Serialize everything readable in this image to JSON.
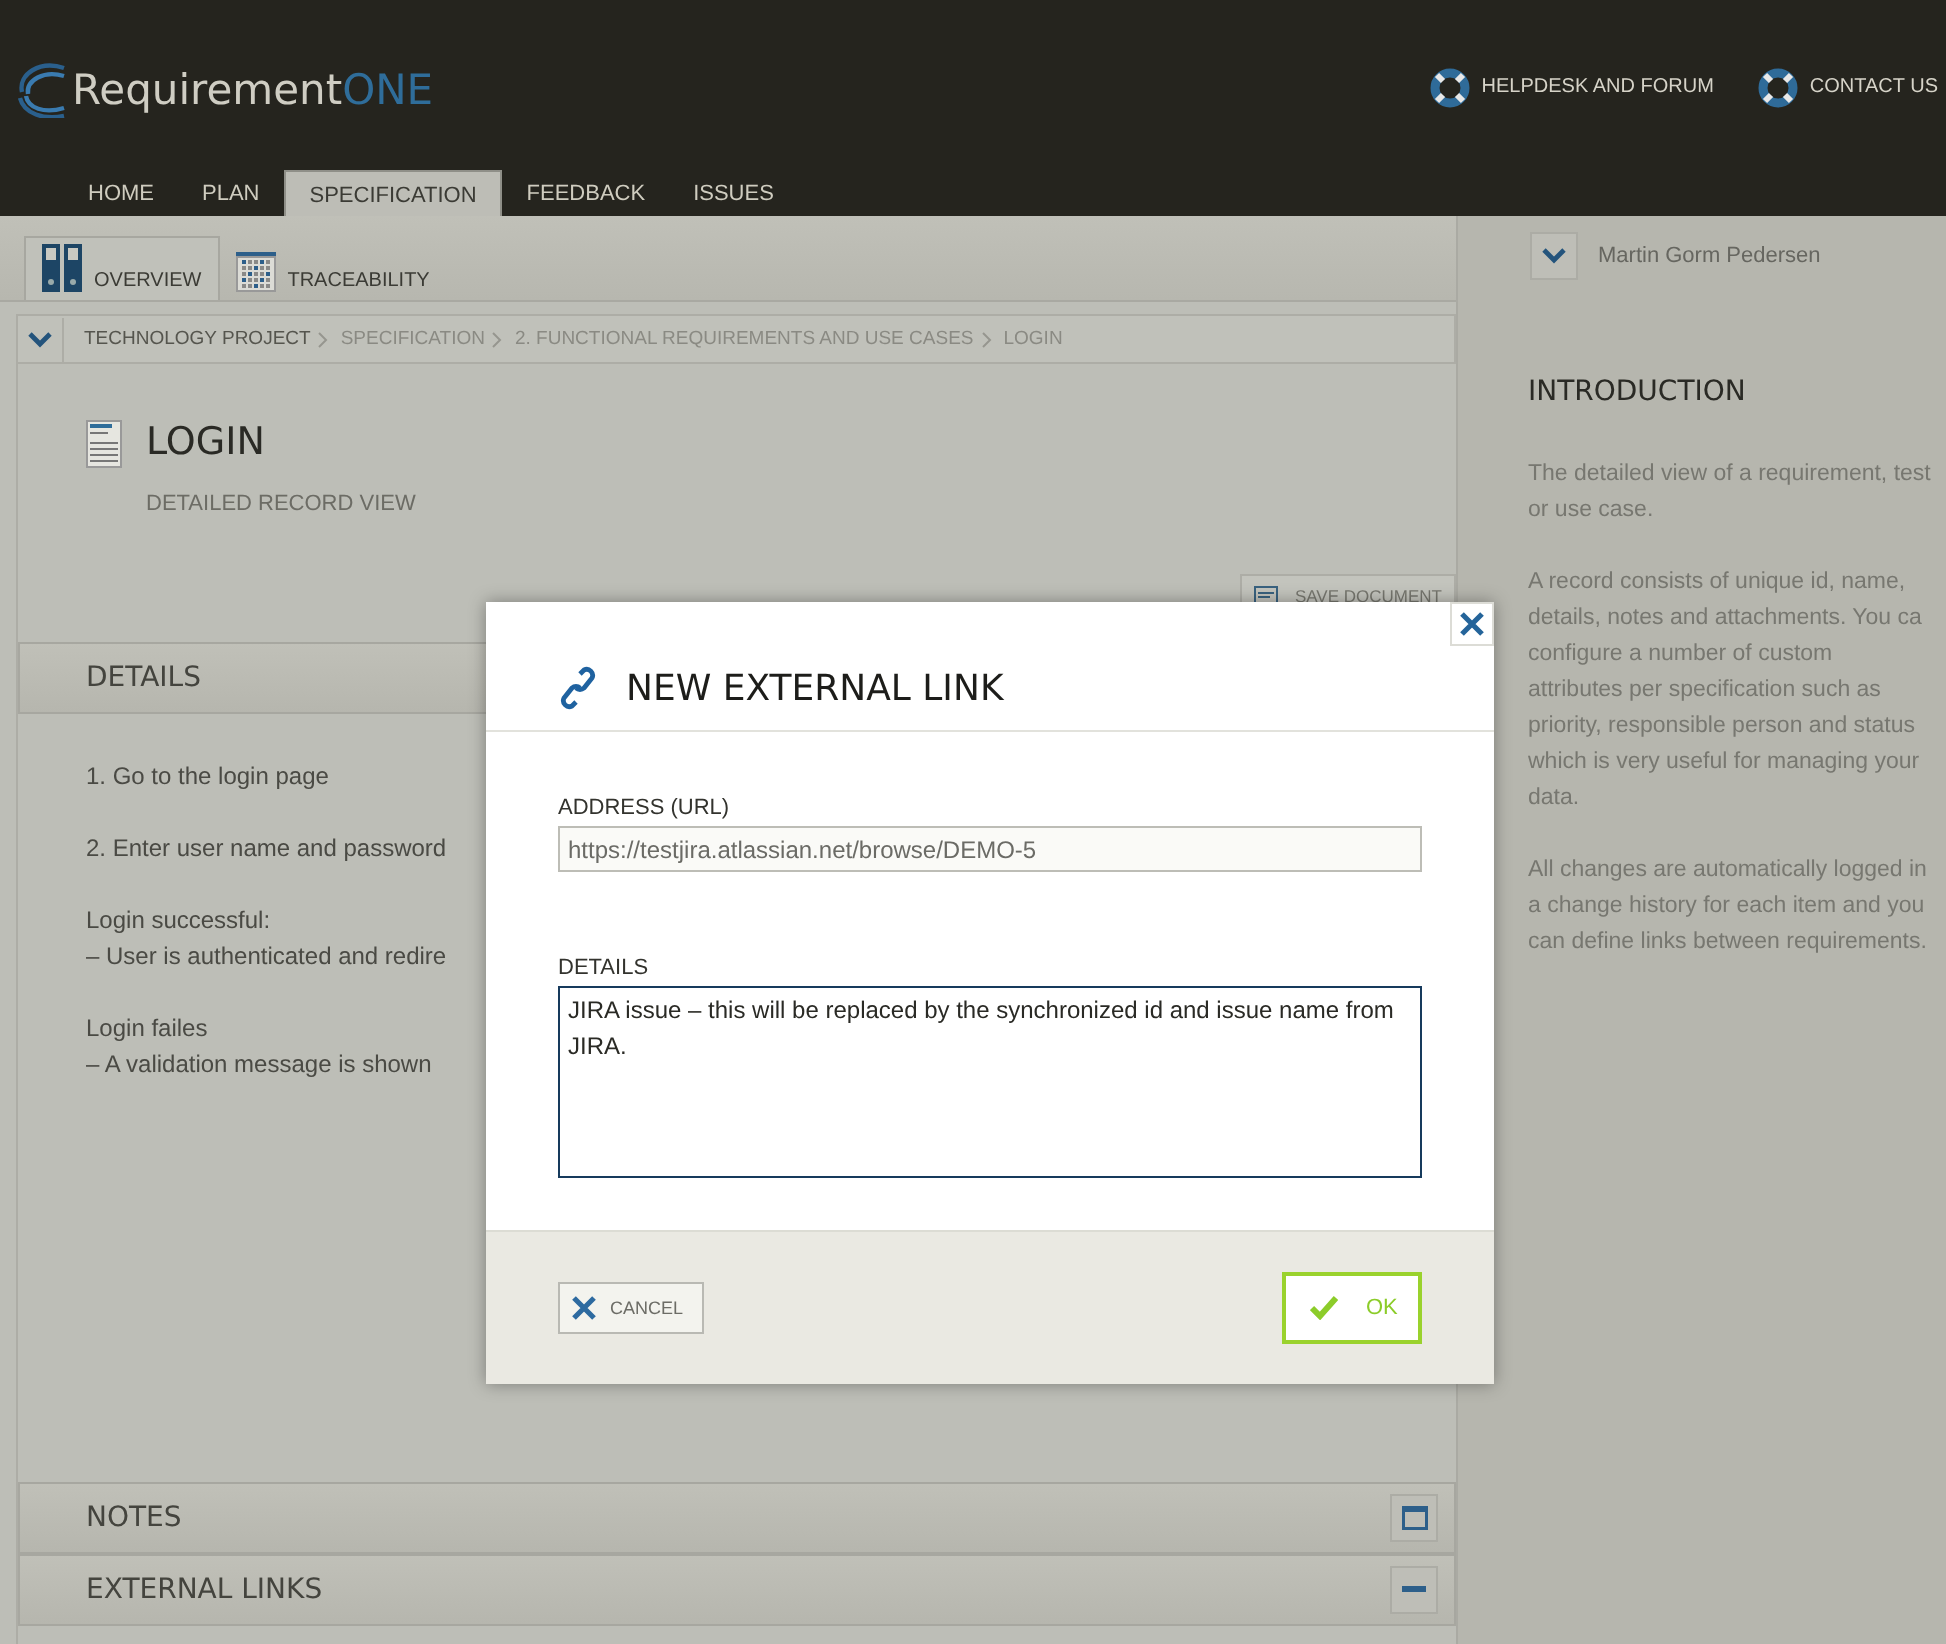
{
  "header": {
    "logo": {
      "text": "Requirement",
      "accent": "ONE"
    },
    "links": [
      {
        "label": "HELPDESK AND FORUM"
      },
      {
        "label": "CONTACT US"
      }
    ]
  },
  "nav_tabs": [
    {
      "label": "HOME",
      "selected": false
    },
    {
      "label": "PLAN",
      "selected": false
    },
    {
      "label": "SPECIFICATION",
      "selected": true
    },
    {
      "label": "FEEDBACK",
      "selected": false
    },
    {
      "label": "ISSUES",
      "selected": false
    }
  ],
  "sub_tabs": [
    {
      "label": "OVERVIEW",
      "selected": true,
      "kind": "binders"
    },
    {
      "label": "TRACEABILITY",
      "selected": false,
      "kind": "grid"
    }
  ],
  "user": {
    "name": "Martin Gorm Pedersen"
  },
  "breadcrumb": [
    "TECHNOLOGY PROJECT",
    "SPECIFICATION",
    "2. FUNCTIONAL REQUIREMENTS AND USE CASES",
    "LOGIN"
  ],
  "record": {
    "title": "LOGIN",
    "subtitle": "DETAILED RECORD VIEW",
    "save_button": "SAVE DOCUMENT"
  },
  "details": {
    "title": "DETAILS",
    "paragraphs": [
      [
        "1. Go to the login page"
      ],
      [
        "2. Enter user name and password"
      ],
      [
        "Login successful:",
        "– User is authenticated and redire"
      ],
      [
        "Login failes",
        "– A validation message is shown"
      ]
    ]
  },
  "sections": [
    {
      "title": "NOTES",
      "expanded": false
    },
    {
      "title": "EXTERNAL LINKS",
      "expanded": true
    }
  ],
  "introduction": {
    "title": "INTRODUCTION",
    "paragraphs": [
      [
        "The detailed view of a requirement, test",
        "or use case."
      ],
      [
        "A record consists of unique id, name,",
        "details, notes and attachments. You ca",
        "configure a number of custom",
        "attributes per specification such as",
        "priority, responsible person and status",
        "which is very useful for managing your",
        "data."
      ],
      [
        "All changes are automatically logged in",
        "a change history for each item and you",
        "can define links between requirements."
      ]
    ]
  },
  "dialog": {
    "title": "NEW EXTERNAL LINK",
    "fields": [
      {
        "label": "ADDRESS (URL)",
        "kind": "input",
        "value": "https://testjira.atlassian.net/browse/DEMO-5",
        "focused": false
      },
      {
        "label": "DETAILS",
        "kind": "textarea",
        "value": "JIRA issue – this will be replaced by the synchronized id and issue name from JIRA.",
        "focused": true
      }
    ],
    "cancel": "CANCEL",
    "ok": "OK"
  }
}
